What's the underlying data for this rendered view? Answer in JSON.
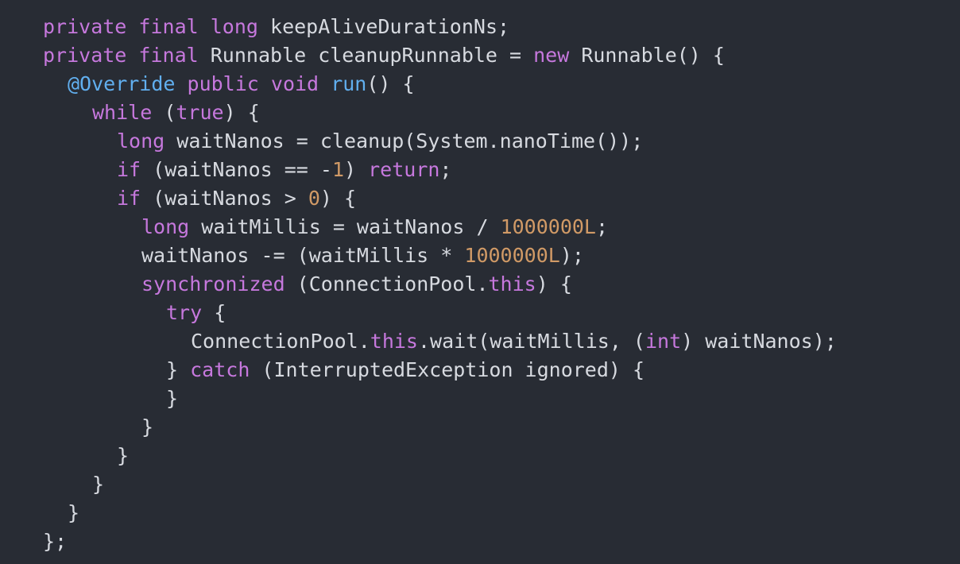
{
  "colors": {
    "background": "#282c34",
    "keyword": "#c678dd",
    "number": "#d19a66",
    "annotation": "#61afef",
    "identifier": "#d7dae0",
    "punctuation": "#abb2bf"
  },
  "code": {
    "lines": [
      {
        "indent": 0,
        "tokens": [
          {
            "text": "private",
            "kind": "keyword"
          },
          {
            "text": " ",
            "kind": "punct"
          },
          {
            "text": "final",
            "kind": "keyword"
          },
          {
            "text": " ",
            "kind": "punct"
          },
          {
            "text": "long",
            "kind": "keyword"
          },
          {
            "text": " keepAliveDurationNs;",
            "kind": "ident"
          }
        ]
      },
      {
        "indent": 0,
        "tokens": [
          {
            "text": "private",
            "kind": "keyword"
          },
          {
            "text": " ",
            "kind": "punct"
          },
          {
            "text": "final",
            "kind": "keyword"
          },
          {
            "text": " Runnable cleanupRunnable = ",
            "kind": "ident"
          },
          {
            "text": "new",
            "kind": "keyword"
          },
          {
            "text": " Runnable() {",
            "kind": "ident"
          }
        ]
      },
      {
        "indent": 1,
        "tokens": [
          {
            "text": "@Override",
            "kind": "annotation"
          },
          {
            "text": " ",
            "kind": "punct"
          },
          {
            "text": "public",
            "kind": "keyword"
          },
          {
            "text": " ",
            "kind": "punct"
          },
          {
            "text": "void",
            "kind": "keyword"
          },
          {
            "text": " ",
            "kind": "punct"
          },
          {
            "text": "run",
            "kind": "function"
          },
          {
            "text": "() {",
            "kind": "ident"
          }
        ]
      },
      {
        "indent": 2,
        "tokens": [
          {
            "text": "while",
            "kind": "keyword"
          },
          {
            "text": " (",
            "kind": "ident"
          },
          {
            "text": "true",
            "kind": "keyword"
          },
          {
            "text": ") {",
            "kind": "ident"
          }
        ]
      },
      {
        "indent": 3,
        "tokens": [
          {
            "text": "long",
            "kind": "keyword"
          },
          {
            "text": " waitNanos = cleanup(System.nanoTime());",
            "kind": "ident"
          }
        ]
      },
      {
        "indent": 3,
        "tokens": [
          {
            "text": "if",
            "kind": "keyword"
          },
          {
            "text": " (waitNanos == -",
            "kind": "ident"
          },
          {
            "text": "1",
            "kind": "number"
          },
          {
            "text": ") ",
            "kind": "ident"
          },
          {
            "text": "return",
            "kind": "keyword"
          },
          {
            "text": ";",
            "kind": "ident"
          }
        ]
      },
      {
        "indent": 3,
        "tokens": [
          {
            "text": "if",
            "kind": "keyword"
          },
          {
            "text": " (waitNanos > ",
            "kind": "ident"
          },
          {
            "text": "0",
            "kind": "number"
          },
          {
            "text": ") {",
            "kind": "ident"
          }
        ]
      },
      {
        "indent": 4,
        "tokens": [
          {
            "text": "long",
            "kind": "keyword"
          },
          {
            "text": " waitMillis = waitNanos / ",
            "kind": "ident"
          },
          {
            "text": "1000000L",
            "kind": "number"
          },
          {
            "text": ";",
            "kind": "ident"
          }
        ]
      },
      {
        "indent": 4,
        "tokens": [
          {
            "text": "waitNanos -= (waitMillis * ",
            "kind": "ident"
          },
          {
            "text": "1000000L",
            "kind": "number"
          },
          {
            "text": ");",
            "kind": "ident"
          }
        ]
      },
      {
        "indent": 4,
        "tokens": [
          {
            "text": "synchronized",
            "kind": "keyword"
          },
          {
            "text": " (ConnectionPool.",
            "kind": "ident"
          },
          {
            "text": "this",
            "kind": "keyword"
          },
          {
            "text": ") {",
            "kind": "ident"
          }
        ]
      },
      {
        "indent": 5,
        "tokens": [
          {
            "text": "try",
            "kind": "keyword"
          },
          {
            "text": " {",
            "kind": "ident"
          }
        ]
      },
      {
        "indent": 6,
        "tokens": [
          {
            "text": "ConnectionPool.",
            "kind": "ident"
          },
          {
            "text": "this",
            "kind": "keyword"
          },
          {
            "text": ".wait(waitMillis, (",
            "kind": "ident"
          },
          {
            "text": "int",
            "kind": "keyword"
          },
          {
            "text": ") waitNanos);",
            "kind": "ident"
          }
        ]
      },
      {
        "indent": 5,
        "tokens": [
          {
            "text": "} ",
            "kind": "ident"
          },
          {
            "text": "catch",
            "kind": "keyword"
          },
          {
            "text": " (InterruptedException ignored) {",
            "kind": "ident"
          }
        ]
      },
      {
        "indent": 5,
        "tokens": [
          {
            "text": "}",
            "kind": "ident"
          }
        ]
      },
      {
        "indent": 4,
        "tokens": [
          {
            "text": "}",
            "kind": "ident"
          }
        ]
      },
      {
        "indent": 3,
        "tokens": [
          {
            "text": "}",
            "kind": "ident"
          }
        ]
      },
      {
        "indent": 2,
        "tokens": [
          {
            "text": "}",
            "kind": "ident"
          }
        ]
      },
      {
        "indent": 1,
        "tokens": [
          {
            "text": "}",
            "kind": "ident"
          }
        ]
      },
      {
        "indent": 0,
        "tokens": [
          {
            "text": "};",
            "kind": "ident"
          }
        ]
      }
    ]
  }
}
